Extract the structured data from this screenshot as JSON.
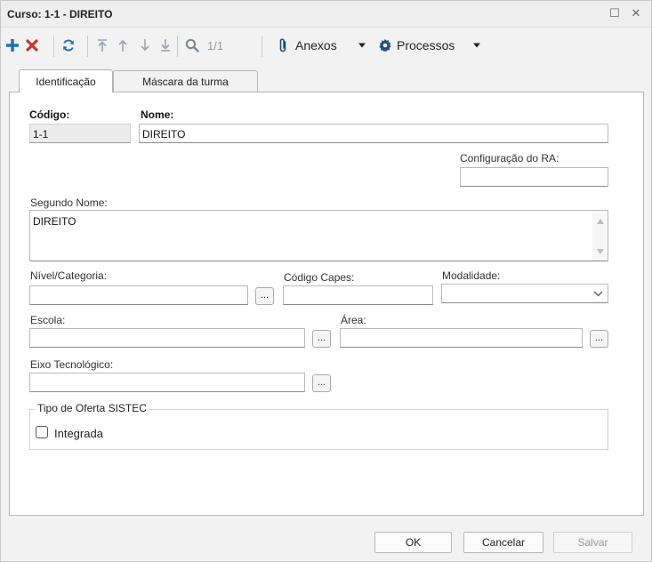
{
  "window": {
    "title": "Curso: 1-1 - DIREITO",
    "maximize_glyph": "☐",
    "close_glyph": "✕"
  },
  "toolbar": {
    "counter": "1/1",
    "anexos_label": "Anexos",
    "processos_label": "Processos",
    "icons": [
      "add-icon",
      "delete-icon",
      "refresh-icon",
      "first-record-icon",
      "previous-record-icon",
      "next-record-icon",
      "last-record-icon",
      "search-icon",
      "attachment-icon",
      "gear-icon"
    ],
    "colors": {
      "add": "#1f6fb5",
      "delete": "#c0392b",
      "refresh": "#1f6fb5",
      "nav_disabled": "#9aa4ae"
    }
  },
  "tabs": [
    {
      "label": "Identificação",
      "active": true
    },
    {
      "label": "Máscara da turma",
      "active": false
    }
  ],
  "form": {
    "codigo": {
      "label": "Código:",
      "value": "1-1"
    },
    "nome": {
      "label": "Nome:",
      "value": "DIREITO"
    },
    "config_ra": {
      "label": "Configuração do RA:",
      "value": ""
    },
    "segundo_nome": {
      "label": "Segundo Nome:",
      "value": "DIREITO"
    },
    "nivel_categoria": {
      "label": "Nível/Categoria:",
      "value": "",
      "button": "..."
    },
    "codigo_capes": {
      "label": "Código Capes:",
      "value": ""
    },
    "modalidade": {
      "label": "Modalidade:",
      "value": ""
    },
    "escola": {
      "label": "Escola:",
      "value": "",
      "button": "..."
    },
    "area": {
      "label": "Área:",
      "value": "",
      "button": "..."
    },
    "eixo_tecnologico": {
      "label": "Eixo Tecnológico:",
      "value": "",
      "button": "..."
    },
    "tipo_oferta": {
      "legend": "Tipo de Oferta SISTEC",
      "integrada_label": "Integrada",
      "integrada_checked": false
    }
  },
  "buttons": {
    "ok": "OK",
    "cancelar": "Cancelar",
    "salvar": "Salvar"
  }
}
